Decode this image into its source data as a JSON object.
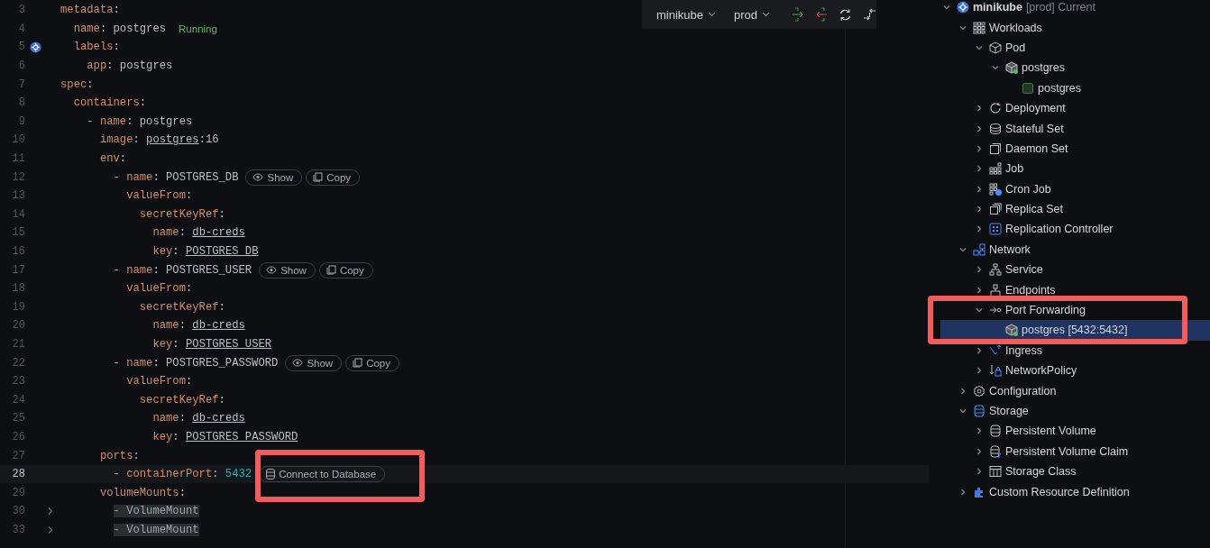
{
  "toolbar": {
    "dropdowns": [
      {
        "label": "minikube"
      },
      {
        "label": "prod"
      }
    ]
  },
  "editor": {
    "lines": [
      {
        "number": "3",
        "current": false,
        "tokens": [
          {
            "kind": "key",
            "text": "metadata"
          },
          {
            "kind": "plain",
            "text": ":"
          }
        ]
      },
      {
        "number": "4",
        "current": false,
        "tokens": [
          {
            "kind": "key",
            "text": "  name"
          },
          {
            "kind": "plain",
            "text": ": postgres"
          }
        ],
        "status": "Running"
      },
      {
        "number": "5",
        "current": false,
        "gutter_marker": true,
        "tokens": [
          {
            "kind": "key",
            "text": "  labels"
          },
          {
            "kind": "plain",
            "text": ":"
          }
        ]
      },
      {
        "number": "6",
        "current": false,
        "tokens": [
          {
            "kind": "key",
            "text": "    app"
          },
          {
            "kind": "plain",
            "text": ": postgres"
          }
        ]
      },
      {
        "number": "7",
        "current": false,
        "tokens": [
          {
            "kind": "key",
            "text": "spec"
          },
          {
            "kind": "plain",
            "text": ":"
          }
        ]
      },
      {
        "number": "8",
        "current": false,
        "tokens": [
          {
            "kind": "key",
            "text": "  containers"
          },
          {
            "kind": "plain",
            "text": ":"
          }
        ]
      },
      {
        "number": "9",
        "current": false,
        "tokens": [
          {
            "kind": "plain",
            "text": "    - "
          },
          {
            "kind": "key",
            "text": "name"
          },
          {
            "kind": "plain",
            "text": ": postgres"
          }
        ]
      },
      {
        "number": "10",
        "current": false,
        "tokens": [
          {
            "kind": "key",
            "text": "      image"
          },
          {
            "kind": "plain",
            "text": ": "
          },
          {
            "kind": "link",
            "text": "postgres"
          },
          {
            "kind": "plain",
            "text": ":16"
          }
        ]
      },
      {
        "number": "11",
        "current": false,
        "tokens": [
          {
            "kind": "key",
            "text": "      env"
          },
          {
            "kind": "plain",
            "text": ":"
          }
        ]
      },
      {
        "number": "12",
        "current": false,
        "tokens": [
          {
            "kind": "plain",
            "text": "        - "
          },
          {
            "kind": "key",
            "text": "name"
          },
          {
            "kind": "plain",
            "text": ": POSTGRES_DB"
          }
        ],
        "actions": [
          {
            "kind": "show",
            "label": "Show"
          },
          {
            "kind": "copy",
            "label": "Copy"
          }
        ]
      },
      {
        "number": "13",
        "current": false,
        "tokens": [
          {
            "kind": "key",
            "text": "          valueFrom"
          },
          {
            "kind": "plain",
            "text": ":"
          }
        ]
      },
      {
        "number": "14",
        "current": false,
        "tokens": [
          {
            "kind": "key",
            "text": "            secretKeyRef"
          },
          {
            "kind": "plain",
            "text": ":"
          }
        ]
      },
      {
        "number": "15",
        "current": false,
        "tokens": [
          {
            "kind": "key",
            "text": "              name"
          },
          {
            "kind": "plain",
            "text": ": "
          },
          {
            "kind": "link",
            "text": "db-creds"
          }
        ]
      },
      {
        "number": "16",
        "current": false,
        "tokens": [
          {
            "kind": "key",
            "text": "              key"
          },
          {
            "kind": "plain",
            "text": ": "
          },
          {
            "kind": "link",
            "text": "POSTGRES_DB"
          }
        ]
      },
      {
        "number": "17",
        "current": false,
        "tokens": [
          {
            "kind": "plain",
            "text": "        - "
          },
          {
            "kind": "key",
            "text": "name"
          },
          {
            "kind": "plain",
            "text": ": POSTGRES_USER"
          }
        ],
        "actions": [
          {
            "kind": "show",
            "label": "Show"
          },
          {
            "kind": "copy",
            "label": "Copy"
          }
        ]
      },
      {
        "number": "18",
        "current": false,
        "tokens": [
          {
            "kind": "key",
            "text": "          valueFrom"
          },
          {
            "kind": "plain",
            "text": ":"
          }
        ]
      },
      {
        "number": "19",
        "current": false,
        "tokens": [
          {
            "kind": "key",
            "text": "            secretKeyRef"
          },
          {
            "kind": "plain",
            "text": ":"
          }
        ]
      },
      {
        "number": "20",
        "current": false,
        "tokens": [
          {
            "kind": "key",
            "text": "              name"
          },
          {
            "kind": "plain",
            "text": ": "
          },
          {
            "kind": "link",
            "text": "db-creds"
          }
        ]
      },
      {
        "number": "21",
        "current": false,
        "tokens": [
          {
            "kind": "key",
            "text": "              key"
          },
          {
            "kind": "plain",
            "text": ": "
          },
          {
            "kind": "link",
            "text": "POSTGRES_USER"
          }
        ]
      },
      {
        "number": "22",
        "current": false,
        "tokens": [
          {
            "kind": "plain",
            "text": "        - "
          },
          {
            "kind": "key",
            "text": "name"
          },
          {
            "kind": "plain",
            "text": ": POSTGRES_PASSWORD"
          }
        ],
        "actions": [
          {
            "kind": "show",
            "label": "Show"
          },
          {
            "kind": "copy",
            "label": "Copy"
          }
        ]
      },
      {
        "number": "23",
        "current": false,
        "tokens": [
          {
            "kind": "key",
            "text": "          valueFrom"
          },
          {
            "kind": "plain",
            "text": ":"
          }
        ]
      },
      {
        "number": "24",
        "current": false,
        "tokens": [
          {
            "kind": "key",
            "text": "            secretKeyRef"
          },
          {
            "kind": "plain",
            "text": ":"
          }
        ]
      },
      {
        "number": "25",
        "current": false,
        "tokens": [
          {
            "kind": "key",
            "text": "              name"
          },
          {
            "kind": "plain",
            "text": ": "
          },
          {
            "kind": "link",
            "text": "db-creds"
          }
        ]
      },
      {
        "number": "26",
        "current": false,
        "tokens": [
          {
            "kind": "key",
            "text": "              key"
          },
          {
            "kind": "plain",
            "text": ": "
          },
          {
            "kind": "link",
            "text": "POSTGRES_PASSWORD"
          }
        ]
      },
      {
        "number": "27",
        "current": false,
        "tokens": [
          {
            "kind": "key",
            "text": "      ports"
          },
          {
            "kind": "plain",
            "text": ":"
          }
        ]
      },
      {
        "number": "28",
        "current": true,
        "tokens": [
          {
            "kind": "plain",
            "text": "        - "
          },
          {
            "kind": "key",
            "text": "containerPort"
          },
          {
            "kind": "plain",
            "text": ": "
          },
          {
            "kind": "number",
            "text": "5432"
          }
        ],
        "actions": [
          {
            "kind": "database",
            "label": "Connect to Database"
          }
        ]
      },
      {
        "number": "29",
        "current": false,
        "tokens": [
          {
            "kind": "key",
            "text": "      volumeMounts"
          },
          {
            "kind": "plain",
            "text": ":"
          }
        ]
      },
      {
        "number": "30",
        "current": false,
        "folded": true,
        "tokens": [
          {
            "kind": "fold",
            "text": "        - VolumeMount"
          }
        ]
      },
      {
        "number": "33",
        "current": false,
        "folded": true,
        "tokens": [
          {
            "kind": "fold",
            "text": "        - VolumeMount"
          }
        ]
      }
    ]
  },
  "tree": [
    {
      "kind": "cluster",
      "label": "minikube",
      "detail": "[prod] Current",
      "expanded": true,
      "selected": false,
      "children": [
        {
          "kind": "workloads",
          "label": "Workloads",
          "expanded": true,
          "selected": false,
          "children": [
            {
              "kind": "pod",
              "label": "Pod",
              "expanded": true,
              "selected": false,
              "children": [
                {
                  "kind": "pod-running",
                  "label": "postgres",
                  "expanded": true,
                  "selected": false,
                  "children": [
                    {
                      "kind": "container",
                      "label": "postgres",
                      "selected": false
                    }
                  ]
                }
              ]
            },
            {
              "kind": "deployment",
              "label": "Deployment",
              "expanded": false,
              "selected": false
            },
            {
              "kind": "statefulset",
              "label": "Stateful Set",
              "expanded": false,
              "selected": false
            },
            {
              "kind": "daemonset",
              "label": "Daemon Set",
              "expanded": false,
              "selected": false
            },
            {
              "kind": "job",
              "label": "Job",
              "expanded": false,
              "selected": false
            },
            {
              "kind": "cronjob",
              "label": "Cron Job",
              "expanded": false,
              "selected": false
            },
            {
              "kind": "replicaset",
              "label": "Replica Set",
              "expanded": false,
              "selected": false
            },
            {
              "kind": "replicationcontroller",
              "label": "Replication Controller",
              "expanded": false,
              "selected": false
            }
          ]
        },
        {
          "kind": "network",
          "label": "Network",
          "expanded": true,
          "selected": false,
          "children": [
            {
              "kind": "service",
              "label": "Service",
              "expanded": false,
              "selected": false
            },
            {
              "kind": "endpoints",
              "label": "Endpoints",
              "expanded": false,
              "selected": false
            },
            {
              "kind": "portforward",
              "label": "Port Forwarding",
              "expanded": true,
              "selected": false,
              "children": [
                {
                  "kind": "pod-running",
                  "label": "postgres [5432:5432]",
                  "selected": true
                }
              ]
            },
            {
              "kind": "ingress",
              "label": "Ingress",
              "expanded": false,
              "selected": false
            },
            {
              "kind": "networkpolicy",
              "label": "NetworkPolicy",
              "expanded": false,
              "selected": false
            }
          ]
        },
        {
          "kind": "configuration",
          "label": "Configuration",
          "expanded": false,
          "selected": false
        },
        {
          "kind": "storage",
          "label": "Storage",
          "expanded": true,
          "selected": false,
          "children": [
            {
              "kind": "pv",
              "label": "Persistent Volume",
              "expanded": false,
              "selected": false
            },
            {
              "kind": "pvc",
              "label": "Persistent Volume Claim",
              "expanded": false,
              "selected": false
            },
            {
              "kind": "storageclass",
              "label": "Storage Class",
              "expanded": false,
              "selected": false
            }
          ]
        },
        {
          "kind": "crd",
          "label": "Custom Resource Definition",
          "expanded": false,
          "selected": false
        }
      ]
    }
  ]
}
